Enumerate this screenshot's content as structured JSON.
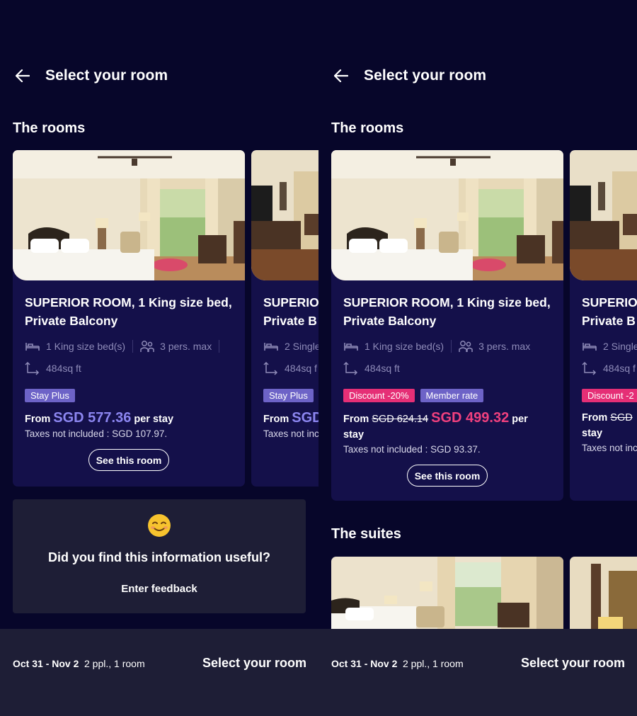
{
  "screens": [
    {
      "header": {
        "title": "Select your room"
      },
      "section_title": "The rooms",
      "card": {
        "name_line1": "SUPERIOR ROOM, 1 King size bed,",
        "name_line2": "Private Balcony",
        "bed": "1 King size bed(s)",
        "persons": "3 pers. max",
        "area": "484sq ft",
        "badge1": "Stay Plus",
        "from": "From",
        "price": "SGD 577.36",
        "per_stay": "per stay",
        "taxes": "Taxes not included : SGD 107.97.",
        "button": "See this room"
      },
      "peek": {
        "name_line1": "SUPERIOR",
        "name_line2": "Private B",
        "bed": "2 Single",
        "area": "484sq f",
        "badge1": "Stay Plus",
        "from": "From",
        "price": "SGD",
        "taxes": "Taxes not inc"
      },
      "feedback": {
        "question": "Did you find this information useful?",
        "enter": "Enter feedback"
      },
      "bottom": {
        "dates": "Oct 31 - Nov 2",
        "people": "2 ppl., 1 room",
        "select": "Select your room"
      }
    },
    {
      "header": {
        "title": "Select your room"
      },
      "section_title": "The rooms",
      "card": {
        "name_line1": "SUPERIOR ROOM, 1 King size bed,",
        "name_line2": "Private Balcony",
        "bed": "1 King size bed(s)",
        "persons": "3 pers. max",
        "area": "484sq ft",
        "badge1": "Discount -20%",
        "badge2": "Member rate",
        "from": "From",
        "old_price": "SGD 624.14",
        "price": "SGD 499.32",
        "per": "per",
        "stay": "stay",
        "taxes": "Taxes not included : SGD 93.37.",
        "button": "See this room"
      },
      "peek": {
        "name_line1": "SUPERIO",
        "name_line2": "Private B",
        "bed": "2 Single",
        "area": "484sq f",
        "badge1": "Discount -2",
        "from": "From",
        "old_price": "SGD",
        "stay": "stay",
        "taxes": "Taxes not inc"
      },
      "suites_title": "The suites",
      "bottom": {
        "dates": "Oct 31 - Nov 2",
        "people": "2 ppl., 1 room",
        "select": "Select your room"
      }
    }
  ],
  "colors": {
    "background": "#07062a",
    "card": "#14104a",
    "accent_blue": "#8c86f0",
    "accent_pink": "#f0407e",
    "badge_purple": "#6d63c7",
    "badge_pink": "#e52f76",
    "bar": "#1e1e36"
  },
  "icons": [
    "back-arrow-icon",
    "bed-icon",
    "persons-icon",
    "area-icon",
    "smiling-emoji-icon"
  ]
}
